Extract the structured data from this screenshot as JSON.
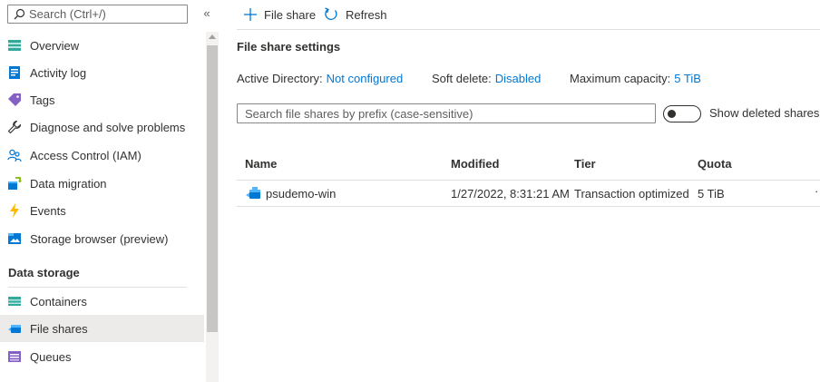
{
  "sidebar": {
    "search_placeholder": "Search (Ctrl+/)",
    "collapse_glyph": "«",
    "items": [
      {
        "label": "Overview",
        "icon": "overview-icon"
      },
      {
        "label": "Activity log",
        "icon": "activity-log-icon"
      },
      {
        "label": "Tags",
        "icon": "tag-icon"
      },
      {
        "label": "Diagnose and solve problems",
        "icon": "wrench-icon"
      },
      {
        "label": "Access Control (IAM)",
        "icon": "people-icon"
      },
      {
        "label": "Data migration",
        "icon": "data-migration-icon"
      },
      {
        "label": "Events",
        "icon": "lightning-icon"
      },
      {
        "label": "Storage browser (preview)",
        "icon": "storage-browser-icon"
      }
    ],
    "section_heading": "Data storage",
    "data_storage_items": [
      {
        "label": "Containers",
        "icon": "containers-icon",
        "active": false
      },
      {
        "label": "File shares",
        "icon": "file-shares-icon",
        "active": true
      },
      {
        "label": "Queues",
        "icon": "queues-icon",
        "active": false
      }
    ]
  },
  "toolbar": {
    "add_label": "File share",
    "refresh_label": "Refresh"
  },
  "settings": {
    "title": "File share settings",
    "active_directory_label": "Active Directory:",
    "active_directory_value": "Not configured",
    "soft_delete_label": "Soft delete:",
    "soft_delete_value": "Disabled",
    "max_capacity_label": "Maximum capacity:",
    "max_capacity_value": "5 TiB"
  },
  "filter": {
    "placeholder": "Search file shares by prefix (case-sensitive)",
    "toggle_label": "Show deleted shares",
    "toggle_on": false
  },
  "table": {
    "columns": [
      "Name",
      "Modified",
      "Tier",
      "Quota"
    ],
    "rows": [
      {
        "name": "psudemo-win",
        "modified": "1/27/2022, 8:31:21 AM",
        "tier": "Transaction optimized",
        "quota": "5 TiB",
        "more": "·"
      }
    ]
  },
  "colors": {
    "accent": "#0078d4",
    "active_nav_bg": "#edebe9"
  }
}
